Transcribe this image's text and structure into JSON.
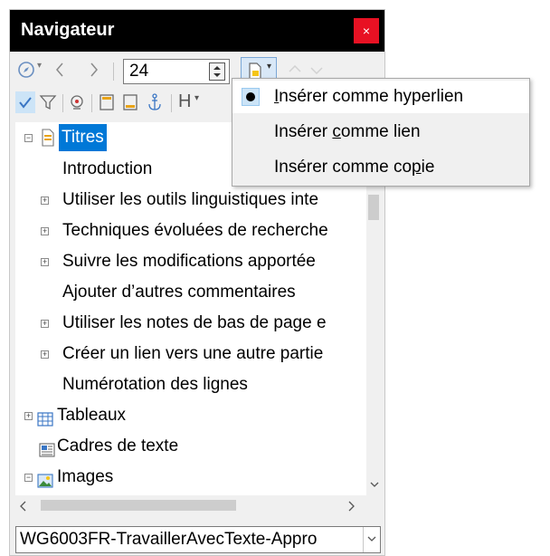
{
  "window": {
    "title": "Navigateur",
    "close_glyph": "×"
  },
  "toolbar": {
    "chapter_spin_value": "24",
    "icons_row1": [
      "navigate-compass-icon",
      "dropdown-arrow-icon",
      "previous-icon",
      "next-icon",
      "drag-mode-icon",
      "move-up-icon",
      "move-down-icon"
    ],
    "icons_row2": [
      "content-view-icon",
      "filter-icon",
      "set-reminder-icon",
      "header-icon",
      "footer-icon",
      "anchor-icon",
      "heading-levels-icon"
    ],
    "heading_levels_label": "H"
  },
  "tree": {
    "items": [
      {
        "label": "Titres",
        "expander": "minus",
        "icon": "headings-icon",
        "selected": true,
        "level": 0
      },
      {
        "label": "Introduction",
        "expander": "",
        "level": 1
      },
      {
        "label": "Utiliser les outils linguistiques inte",
        "expander": "plus",
        "level": 1
      },
      {
        "label": "Techniques évoluées de recherche",
        "expander": "plus",
        "level": 1
      },
      {
        "label": "Suivre les modifications apportée",
        "expander": "plus",
        "level": 1
      },
      {
        "label": "Ajouter d’autres commentaires",
        "expander": "",
        "level": 1
      },
      {
        "label": "Utiliser les notes de bas de page e",
        "expander": "plus",
        "level": 1
      },
      {
        "label": "Créer un lien vers une autre partie",
        "expander": "plus",
        "level": 1
      },
      {
        "label": "Numérotation des lignes",
        "expander": "",
        "level": 1
      },
      {
        "label": "Tableaux",
        "expander": "plus",
        "icon": "table-icon",
        "level": 0
      },
      {
        "label": "Cadres de texte",
        "expander": "",
        "icon": "text-frame-icon",
        "level": 0
      },
      {
        "label": "Images",
        "expander": "minus",
        "icon": "image-icon",
        "level": 0
      }
    ]
  },
  "document_select": {
    "value": "WG6003FR-TravaillerAvecTexte-Appro"
  },
  "drag_mode_menu": {
    "items": [
      {
        "label": "Insérer comme hyperlien",
        "checked": true
      },
      {
        "label": "Insérer comme lien",
        "checked": false
      },
      {
        "label": "Insérer comme copie",
        "checked": false
      }
    ]
  },
  "colors": {
    "selection": "#0078d7",
    "close_button": "#e81123",
    "title_bar": "#000000"
  }
}
